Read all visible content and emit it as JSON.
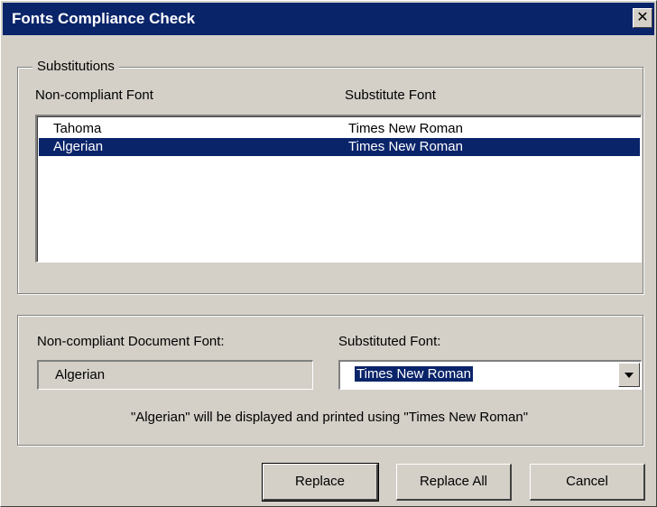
{
  "window": {
    "title": "Fonts Compliance Check",
    "close_label": "✕"
  },
  "substitutions": {
    "legend": "Substitutions",
    "columns": [
      "Non-compliant Font",
      "Substitute Font"
    ],
    "rows": [
      {
        "font": "Tahoma",
        "substitute": "Times New Roman",
        "selected": false
      },
      {
        "font": "Algerian",
        "substitute": "Times New Roman",
        "selected": true
      }
    ]
  },
  "details": {
    "document_font_label": "Non-compliant Document Font:",
    "document_font_value": "Algerian",
    "substituted_font_label": "Substituted Font:",
    "substituted_font_value": "Times New Roman",
    "message": "\"Algerian\" will be displayed and printed using \"Times New Roman\""
  },
  "buttons": {
    "replace": "Replace",
    "replace_all": "Replace All",
    "cancel": "Cancel"
  },
  "colors": {
    "titlebar": "#0a246a",
    "face": "#d4d0c8",
    "selection": "#0a246a"
  }
}
